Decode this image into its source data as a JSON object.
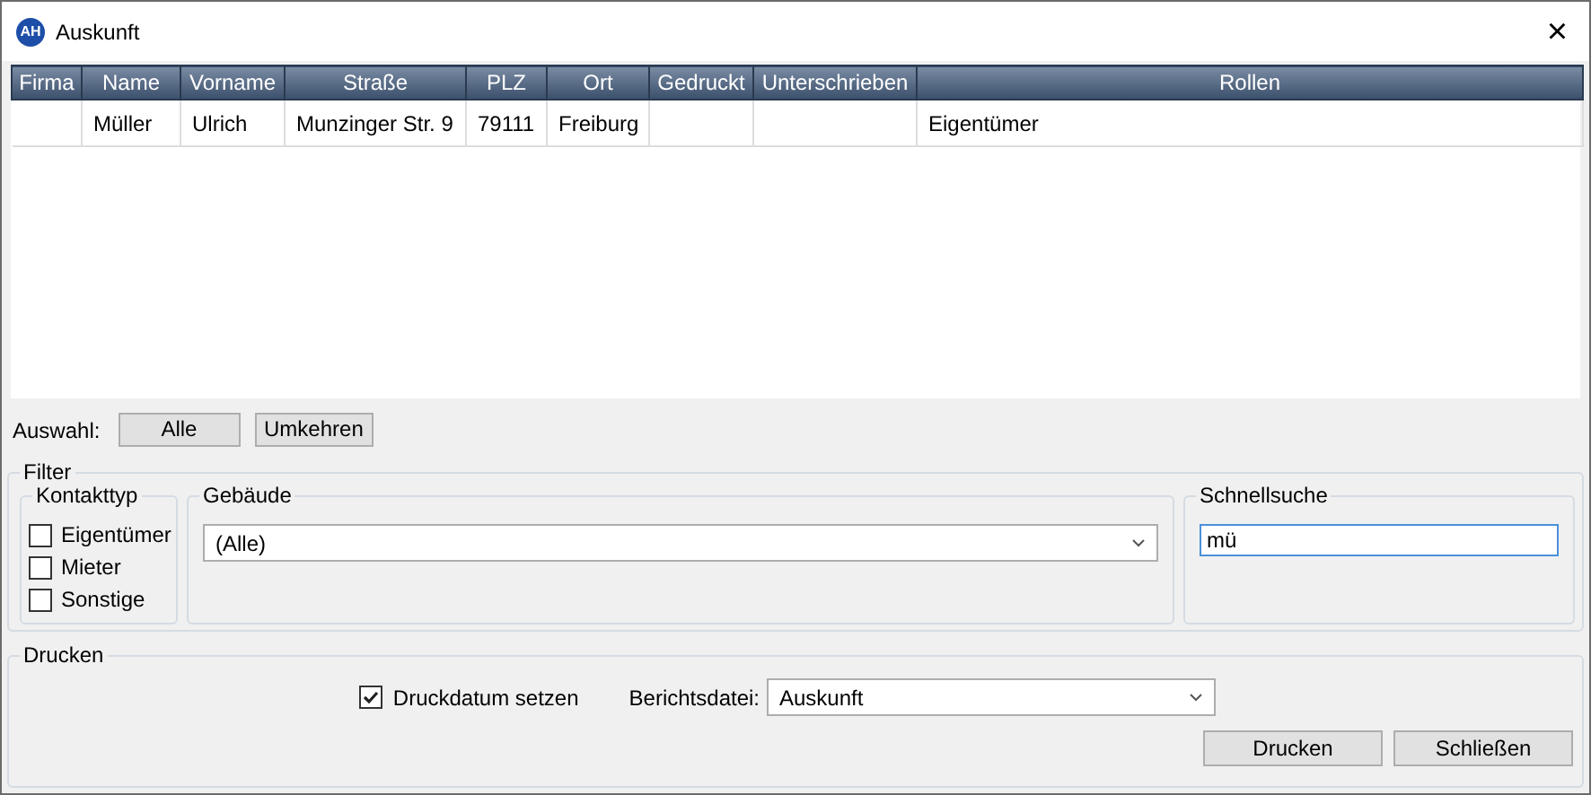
{
  "window": {
    "title": "Auskunft",
    "icon_text": "AH",
    "close": "×"
  },
  "table": {
    "columns": [
      "Firma",
      "Name",
      "Vorname",
      "Straße",
      "PLZ",
      "Ort",
      "Gedruckt",
      "Unterschrieben",
      "Rollen"
    ],
    "rows": [
      [
        "",
        "Müller",
        "Ulrich",
        "Munzinger Str. 9",
        "79111",
        "Freiburg",
        "",
        "",
        "Eigentümer"
      ]
    ]
  },
  "selection": {
    "label": "Auswahl:",
    "buttons": [
      "Alle",
      "Umkehren"
    ]
  },
  "filter": {
    "title": "Filter",
    "contact_type": {
      "title": "Kontakttyp",
      "options": [
        {
          "label": "Eigentümer",
          "checked": false
        },
        {
          "label": "Mieter",
          "checked": false
        },
        {
          "label": "Sonstige",
          "checked": false
        }
      ]
    },
    "building": {
      "title": "Gebäude",
      "value": "(Alle)"
    },
    "quick_search": {
      "title": "Schnellsuche",
      "value": "mü"
    }
  },
  "print": {
    "title": "Drucken",
    "set_date": {
      "label": "Druckdatum setzen",
      "checked": true
    },
    "report_file": {
      "label": "Berichtsdatei:",
      "value": "Auskunft"
    },
    "buttons": [
      "Drucken",
      "Schließen"
    ]
  }
}
